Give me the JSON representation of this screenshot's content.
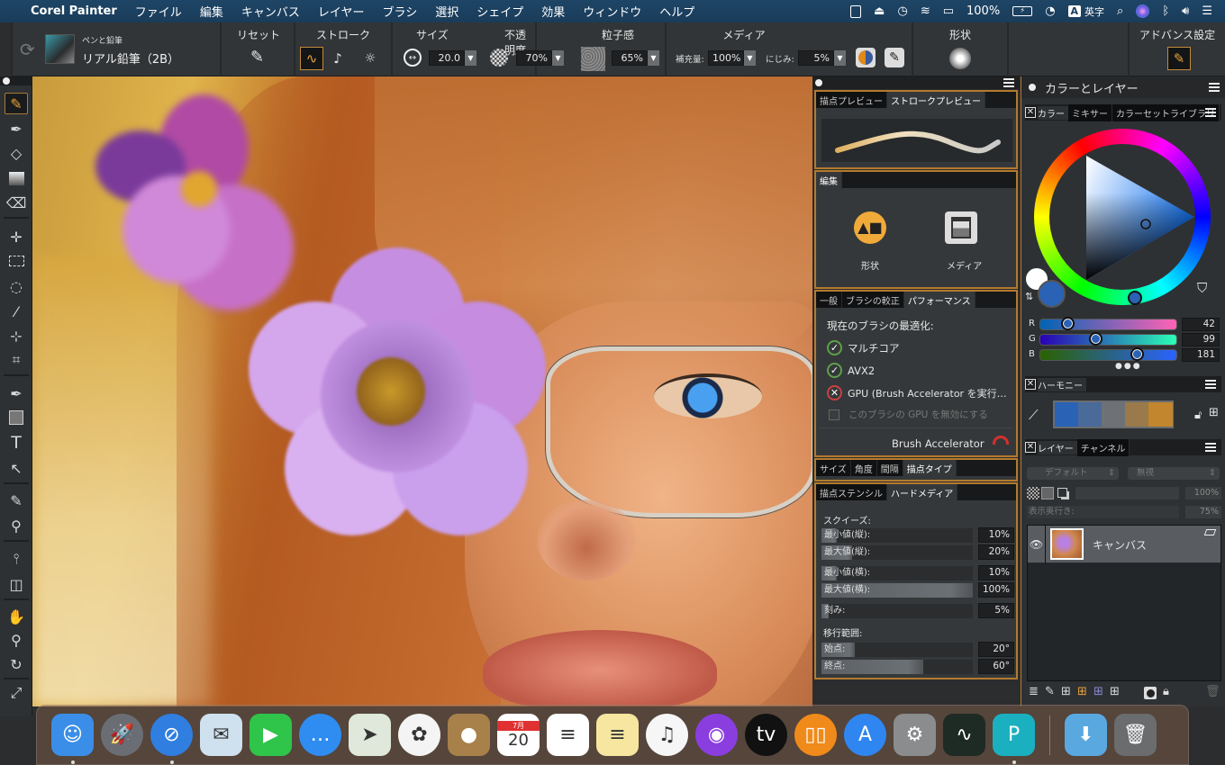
{
  "menubar": {
    "apple_icon": "apple-icon",
    "app_name": "Corel Painter",
    "menus": [
      "ファイル",
      "編集",
      "キャンバス",
      "レイヤー",
      "ブラシ",
      "選択",
      "シェイプ",
      "効果",
      "ウィンドウ",
      "ヘルプ"
    ],
    "status": {
      "battery": "100%",
      "input_mode": "A",
      "input_label": "英字"
    },
    "status_icons": [
      "tablet-icon",
      "eject-icon",
      "time-machine-icon",
      "wifi-icon",
      "airplay-icon",
      "battery-icon",
      "clock-icon",
      "input-source-icon",
      "spotlight-icon",
      "siri-icon",
      "bluetooth-icon",
      "volume-icon",
      "notification-center-icon"
    ]
  },
  "toolbar": {
    "brush_category": "ペンと鉛筆",
    "brush_variant": "リアル鉛筆（2B）",
    "reset_title": "リセット",
    "stroke_title": "ストローク",
    "size_title": "サイズ",
    "size_value": "20.0",
    "opacity_title": "不透明度",
    "opacity_value": "70%",
    "grain_title": "粒子感",
    "grain_value": "65%",
    "media_title": "メディア",
    "resaturation_label": "補充量:",
    "resaturation_value": "100%",
    "bleed_label": "にじみ:",
    "bleed_value": "5%",
    "shape_title": "形状",
    "advanced_title": "アドバンス設定"
  },
  "tools": [
    "brush",
    "dropper",
    "paint-bucket",
    "gradient",
    "eraser",
    "transform",
    "rectangular-selection",
    "lasso",
    "magic-wand",
    "selection-adjuster",
    "crop",
    "pen",
    "rectangle-shape",
    "text",
    "shape-selection",
    "cloner",
    "clone-source",
    "mirror-painting",
    "perspective-guide",
    "grabber",
    "magnifier",
    "rotate-page",
    "fit-screen"
  ],
  "brush_panel": {
    "preview_tabs": [
      "描点プレビュー",
      "ストロークプレビュー"
    ],
    "preview_active": 1,
    "edit_tab": "編集",
    "edit_items": [
      "形状",
      "メディア"
    ],
    "perf_tabs": [
      "一般",
      "ブラシの較正",
      "パフォーマンス"
    ],
    "perf_active": 2,
    "perf_heading": "現在のブラシの最適化:",
    "perf_items": [
      {
        "label": "マルチコア",
        "ok": true
      },
      {
        "label": "AVX2",
        "ok": true
      },
      {
        "label": "GPU (Brush Accelerator を実行…",
        "ok": false
      }
    ],
    "disable_gpu_label": "このブラシの GPU を無効にする",
    "disable_gpu_checked": false,
    "accelerator_label": "Brush Accelerator",
    "dab_tabs": [
      "サイズ",
      "角度",
      "間隔",
      "描点タイプ"
    ],
    "dab_active": 3,
    "media_tabs": [
      "描点ステンシル",
      "ハードメディア"
    ],
    "media_active": 1,
    "squeeze_heading": "スクイーズ:",
    "squeeze_rows": [
      {
        "label": "最小値(縦):",
        "value": "10%",
        "fraction": 0.1
      },
      {
        "label": "最大値(縦):",
        "value": "20%",
        "fraction": 0.2
      },
      {
        "label": "最小値(横):",
        "value": "10%",
        "fraction": 0.1
      },
      {
        "label": "最大値(横):",
        "value": "100%",
        "fraction": 1.0
      },
      {
        "label": "刻み:",
        "value": "5%",
        "fraction": 0.05
      }
    ],
    "transition_heading": "移行範囲:",
    "transition_rows": [
      {
        "label": "始点:",
        "value": "20°",
        "fraction": 0.22
      },
      {
        "label": "終点:",
        "value": "60°",
        "fraction": 0.67
      }
    ]
  },
  "color_panel": {
    "title": "カラーとレイヤー",
    "color_tabs": [
      "カラー",
      "ミキサー",
      "カラーセットライブラリ"
    ],
    "color_active": 0,
    "main_color": "#2a63b5",
    "secondary_color": "#ffffff",
    "rgb": [
      {
        "label": "R",
        "value": "42"
      },
      {
        "label": "G",
        "value": "99"
      },
      {
        "label": "B",
        "value": "181"
      }
    ],
    "harmony_title": "ハーモニー",
    "harmony_swatches": [
      "#2a63b5",
      "#4a6a9a",
      "#6e7276",
      "#9a7a4a",
      "#c2862e"
    ],
    "layer_tabs": [
      "レイヤー",
      "チャンネル"
    ],
    "layer_active": 0,
    "composite_method": "デフォルト",
    "composite_depth": "無視",
    "opacity_value": "100%",
    "depth_label": "表示奥行き:",
    "depth_value": "75%",
    "layers": [
      {
        "name": "キャンバス",
        "visible": true
      }
    ]
  },
  "dock": {
    "apps": [
      {
        "name": "finder",
        "glyph": "☺",
        "bg": "#3a8ee8",
        "running": true
      },
      {
        "name": "launchpad",
        "glyph": "🚀",
        "bg": "#6a6e74",
        "running": false
      },
      {
        "name": "safari",
        "glyph": "⊘",
        "bg": "#2f7ee0",
        "running": true
      },
      {
        "name": "mail",
        "glyph": "✉",
        "bg": "#cfe0ef",
        "running": false
      },
      {
        "name": "facetime",
        "glyph": "▶",
        "bg": "#2fc44a",
        "running": false
      },
      {
        "name": "messages",
        "glyph": "…",
        "bg": "#2f8cf0",
        "running": false
      },
      {
        "name": "maps",
        "glyph": "➤",
        "bg": "#dfe8da",
        "running": false
      },
      {
        "name": "photos",
        "glyph": "✿",
        "bg": "#f4f4f4",
        "running": false
      },
      {
        "name": "contacts",
        "glyph": "●",
        "bg": "#a8804a",
        "running": false
      },
      {
        "name": "calendar",
        "glyph": "20",
        "bg": "#ffffff",
        "running": false
      },
      {
        "name": "reminders",
        "glyph": "≡",
        "bg": "#ffffff",
        "running": false
      },
      {
        "name": "notes",
        "glyph": "≡",
        "bg": "#f6e6a0",
        "running": false
      },
      {
        "name": "music",
        "glyph": "♫",
        "bg": "#f6f6f6",
        "running": false
      },
      {
        "name": "podcasts",
        "glyph": "◉",
        "bg": "#8a3ee0",
        "running": false
      },
      {
        "name": "apple-tv",
        "glyph": "tv",
        "bg": "#111111",
        "running": false
      },
      {
        "name": "books",
        "glyph": "▯▯",
        "bg": "#f08a1a",
        "running": false
      },
      {
        "name": "app-store",
        "glyph": "A",
        "bg": "#2f86f0",
        "running": false
      },
      {
        "name": "system-preferences",
        "glyph": "⚙",
        "bg": "#8a8c8e",
        "running": false
      },
      {
        "name": "activity-monitor",
        "glyph": "∿",
        "bg": "#1e2a24",
        "running": false
      },
      {
        "name": "corel-painter",
        "glyph": "P",
        "bg": "#1ab0c0",
        "running": true
      },
      {
        "name": "downloads",
        "glyph": "⬇",
        "bg": "#5aa8e0",
        "running": false
      },
      {
        "name": "trash",
        "glyph": "🗑",
        "bg": "#6a6c6e",
        "running": false
      }
    ],
    "calendar_month": "7月"
  }
}
